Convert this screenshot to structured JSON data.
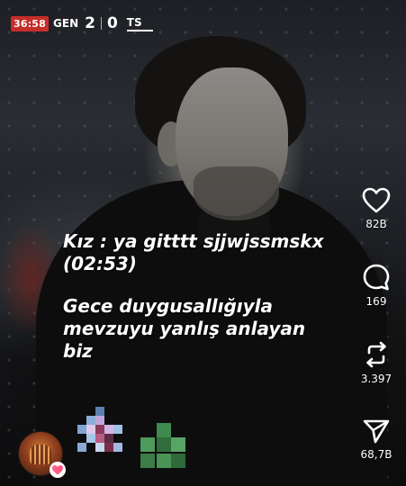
{
  "scoreboard": {
    "clock": "36:58",
    "home_team": "GEN",
    "home_score": "2",
    "away_score": "0",
    "away_team": "TS"
  },
  "caption": {
    "line1": "Kız : ya gitttt sjjwjssmskx",
    "line2": "(02:53)",
    "line3": "Gece duygusallığıyla",
    "line4": "mevzuyu yanlış anlayan",
    "line5": "biz"
  },
  "actions": {
    "like_count": "82B",
    "comment_count": "169",
    "repost_count": "3.397",
    "share_count": "68,7B"
  },
  "icons": {
    "like": "heart-icon",
    "comment": "comment-bubble-icon",
    "repost": "repost-arrows-icon",
    "share": "send-icon",
    "badge": "heart-badge-icon"
  },
  "colors": {
    "clock_bg": "#c62d2a",
    "badge_pink": "#ff5c8a"
  }
}
